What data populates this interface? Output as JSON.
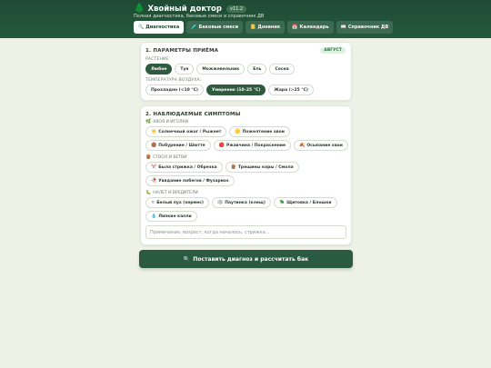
{
  "header": {
    "tree_icon": "🌲",
    "title": "Хвойный доктор",
    "version": "v11.2",
    "subtitle": "Полная диагностика, баковые смеси и справочник ДВ",
    "tabs": [
      {
        "icon": "🔍",
        "label": "Диагностика",
        "active": true
      },
      {
        "icon": "🧪",
        "label": "Баковые смеси",
        "active": false
      },
      {
        "icon": "📒",
        "label": "Дневник",
        "active": false
      },
      {
        "icon": "📅",
        "label": "Календарь",
        "active": false
      },
      {
        "icon": "📖",
        "label": "Справочник ДВ",
        "active": false
      }
    ]
  },
  "params": {
    "title": "1. ПАРАМЕТРЫ ПРИЁМА",
    "season": "АВГУСТ",
    "plant_label": "РАСТЕНИЕ:",
    "plants": [
      {
        "label": "Любое",
        "active": true
      },
      {
        "label": "Туя",
        "active": false
      },
      {
        "label": "Можжевельник",
        "active": false
      },
      {
        "label": "Ель",
        "active": false
      },
      {
        "label": "Сосна",
        "active": false
      }
    ],
    "temp_label": "ТЕМПЕРАТУРА ВОЗДУХА:",
    "temps": [
      {
        "label": "Прохладно (<10 °C)",
        "active": false
      },
      {
        "label": "Умеренно (10–25 °C)",
        "active": true
      },
      {
        "label": "Жара (>25 °C)",
        "active": false
      }
    ]
  },
  "symptoms": {
    "title": "2. НАБЛЮДАЕМЫЕ СИМПТОМЫ",
    "groups": [
      {
        "icon": "🌿",
        "label": "ХВОЯ И ИГОЛКИ",
        "items": [
          {
            "icon": "☀️",
            "label": "Солнечный ожог / Рыжеет"
          },
          {
            "icon": "🟡",
            "label": "Пожелтение хвои"
          },
          {
            "icon": "🟤",
            "label": "Побурение / Шютте"
          },
          {
            "icon": "🔴",
            "label": "Ржавчина / Покраснение"
          },
          {
            "icon": "🍂",
            "label": "Осыпание хвои"
          }
        ]
      },
      {
        "icon": "🪵",
        "label": "СТВОЛ И ВЕТВИ",
        "items": [
          {
            "icon": "✂️",
            "label": "Была стрижка / Обрезка"
          },
          {
            "icon": "🪵",
            "label": "Трещины коры / Смола"
          },
          {
            "icon": "🥀",
            "label": "Увядание побегов / Фузариоз"
          }
        ]
      },
      {
        "icon": "🐛",
        "label": "НАЛЕТ И ВРЕДИТЕЛИ",
        "items": [
          {
            "icon": "⚪",
            "label": "Белый пух (хермес)"
          },
          {
            "icon": "🕸️",
            "label": "Паутинка (клещ)"
          },
          {
            "icon": "🪲",
            "label": "Щитовка / Блошки"
          },
          {
            "icon": "💧",
            "label": "Липкие капли"
          }
        ]
      }
    ],
    "note_placeholder": "Примечание: возраст, когда началось, стрижка…"
  },
  "submit": {
    "icon": "🔍",
    "label": "Поставить диагноз и рассчитать бак"
  }
}
